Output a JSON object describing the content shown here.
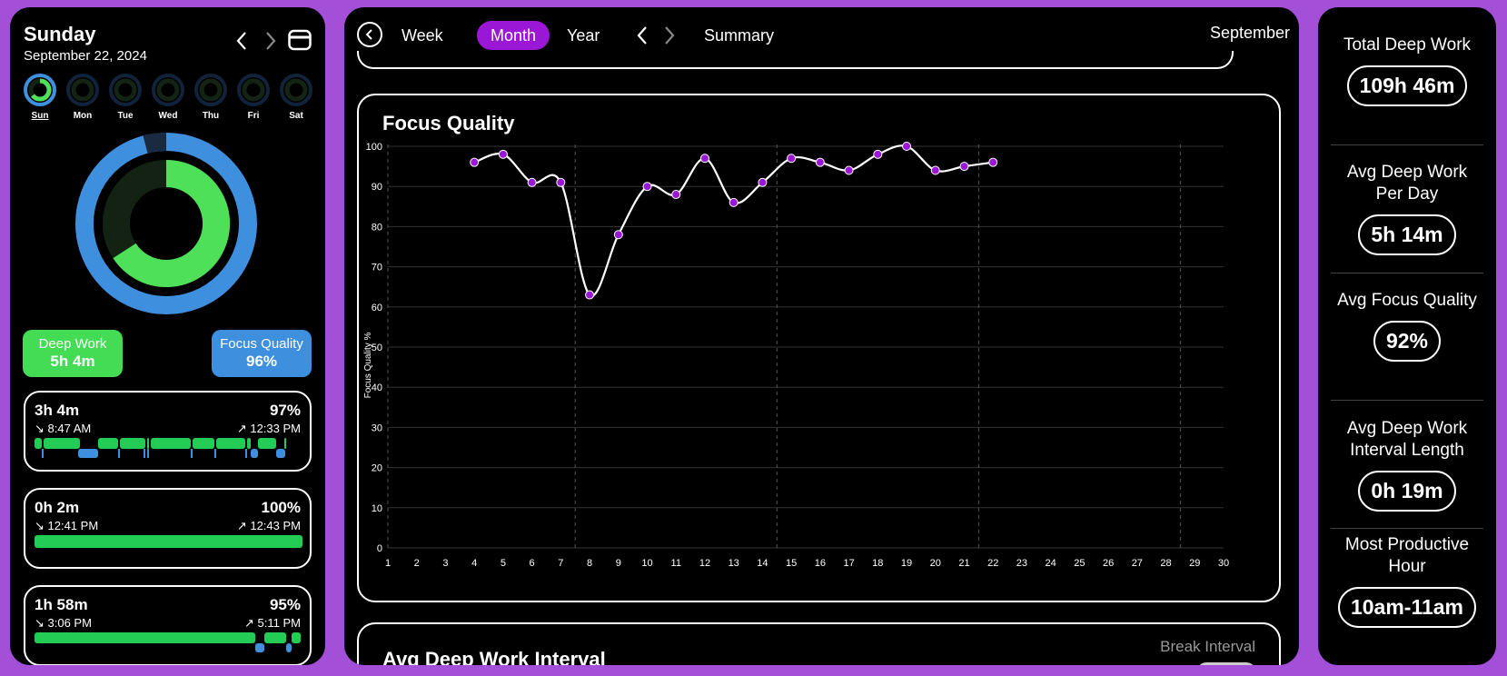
{
  "day": {
    "title": "Sunday",
    "date": "September 22, 2024",
    "week": [
      {
        "label": "Sun",
        "active": true
      },
      {
        "label": "Mon",
        "active": false
      },
      {
        "label": "Tue",
        "active": false
      },
      {
        "label": "Wed",
        "active": false
      },
      {
        "label": "Thu",
        "active": false
      },
      {
        "label": "Fri",
        "active": false
      },
      {
        "label": "Sat",
        "active": false
      }
    ],
    "deep_work_label": "Deep Work",
    "deep_work_value": "5h 4m",
    "focus_quality_label": "Focus Quality",
    "focus_quality_value": "96%",
    "sessions": [
      {
        "duration": "3h 4m",
        "percent": "97%",
        "start": "↘ 8:47 AM",
        "end": "↗ 12:33 PM"
      },
      {
        "duration": "0h 2m",
        "percent": "100%",
        "start": "↘ 12:41 PM",
        "end": "↗ 12:43 PM"
      },
      {
        "duration": "1h 58m",
        "percent": "95%",
        "start": "↘ 3:06 PM",
        "end": "↗ 5:11 PM"
      }
    ]
  },
  "colors": {
    "purple_bg": "#a34fd8",
    "accent_purple": "#9b17d6",
    "green": "#44dc55",
    "blue": "#3f8fdf"
  },
  "nav": {
    "tabs": [
      "Week",
      "Month",
      "Year"
    ],
    "active_tab": "Month",
    "summary_label": "Summary",
    "period": "September"
  },
  "focus_chart": {
    "title": "Focus Quality",
    "break_interval_label": "Break Interval",
    "next_card_title": "Avg Deep Work Interval"
  },
  "chart_data": {
    "type": "line",
    "title": "Focus Quality",
    "ylabel": "Focus Quality %",
    "xlabel": "",
    "x_ticks": [
      1,
      2,
      3,
      4,
      5,
      6,
      7,
      8,
      9,
      10,
      11,
      12,
      13,
      14,
      15,
      16,
      17,
      18,
      19,
      20,
      21,
      22,
      23,
      24,
      25,
      26,
      27,
      28,
      29,
      30
    ],
    "y_ticks": [
      0,
      10,
      20,
      30,
      40,
      50,
      60,
      70,
      80,
      90,
      100
    ],
    "ylim": [
      0,
      100
    ],
    "xlim": [
      1,
      30
    ],
    "grid": true,
    "series": [
      {
        "x": [
          4,
          5,
          6,
          7,
          8,
          9,
          10,
          11,
          12,
          13,
          14,
          15,
          16,
          17,
          18,
          19,
          20,
          21,
          22
        ],
        "y": [
          96,
          98,
          91,
          91,
          63,
          78,
          90,
          88,
          97,
          86,
          91,
          97,
          96,
          94,
          98,
          100,
          94,
          95,
          96
        ]
      }
    ],
    "week_separators_x": [
      7.5,
      14.5,
      21.5,
      28.5
    ]
  },
  "summary": {
    "stats": [
      {
        "label": "Total Deep Work",
        "value": "109h 46m"
      },
      {
        "label": "Avg Deep Work Per Day",
        "value": "5h 14m"
      },
      {
        "label": "Avg Focus Quality",
        "value": "92%"
      },
      {
        "label": "Avg Deep Work Interval Length",
        "value": "0h 19m"
      },
      {
        "label": "Most Productive Hour",
        "value": "10am-11am"
      }
    ]
  }
}
